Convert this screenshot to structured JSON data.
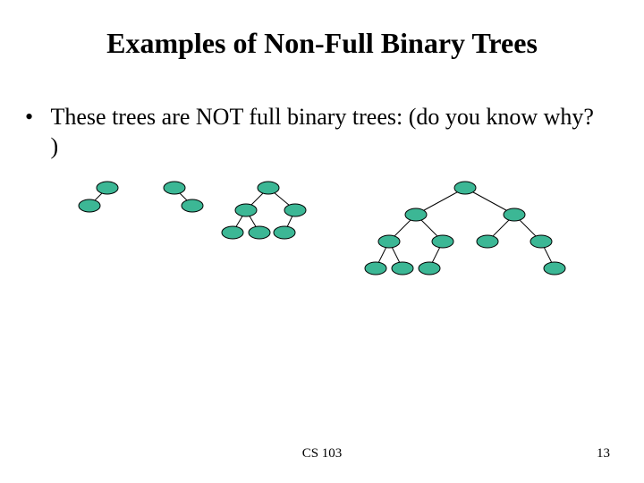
{
  "slide": {
    "title": "Examples of Non-Full Binary Trees",
    "bullet": "These trees are NOT full binary trees: (do you know why? )",
    "footer_course": "CS 103",
    "page_number": "13"
  }
}
